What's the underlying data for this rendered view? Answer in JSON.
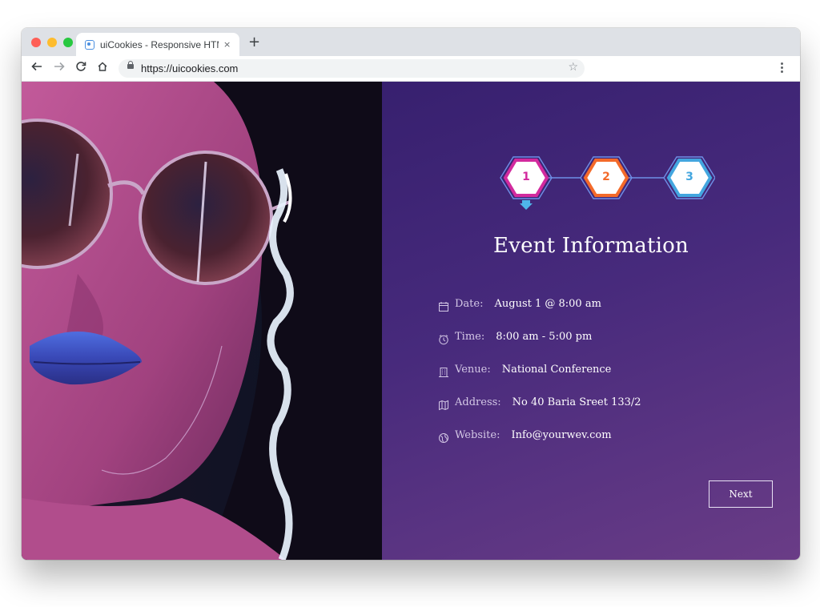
{
  "browser": {
    "tab_title": "uiCookies - Responsive HTML",
    "tab_close": "×",
    "new_tab": "+",
    "url": "https://uicookies.com",
    "icons": [
      "back-icon",
      "forward-icon",
      "reload-icon",
      "home-icon",
      "lock-icon",
      "star-icon",
      "kebab-menu-icon",
      "favicon-icon"
    ]
  },
  "colors": {
    "step1": "#d22a9e",
    "step2": "#f36a2a",
    "step3": "#43a6df",
    "panel_top": "#37206f",
    "panel_bottom": "#6a3c86"
  },
  "steps": [
    {
      "label": "1",
      "active": true
    },
    {
      "label": "2",
      "active": false
    },
    {
      "label": "3",
      "active": false
    }
  ],
  "event": {
    "title": "Event Information",
    "rows": [
      {
        "icon": "calendar-icon",
        "label": "Date:",
        "value": "August 1 @ 8:00 am"
      },
      {
        "icon": "clock-icon",
        "label": "Time:",
        "value": "8:00 am - 5:00 pm"
      },
      {
        "icon": "building-icon",
        "label": "Venue:",
        "value": "National Conference"
      },
      {
        "icon": "map-icon",
        "label": "Address:",
        "value": "No 40 Baria Sreet 133/2"
      },
      {
        "icon": "globe-icon",
        "label": "Website:",
        "value": "Info@yourwev.com"
      }
    ],
    "next_label": "Next"
  }
}
